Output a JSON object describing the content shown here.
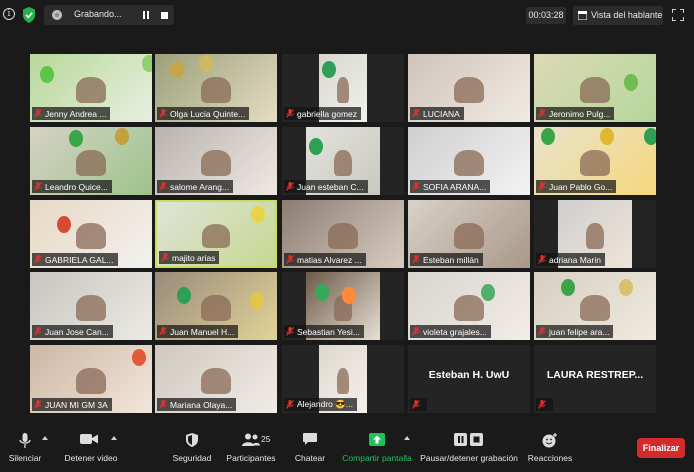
{
  "topbar": {
    "recording_label": "Grabando...",
    "timer": "00:03:28",
    "view_label": "Vista del hablante"
  },
  "participants": [
    {
      "name": "Jenny Andrea ..."
    },
    {
      "name": "Olga Lucia Quinte..."
    },
    {
      "name": "gabriella gomez"
    },
    {
      "name": "LUCIANA"
    },
    {
      "name": "Jeronimo Pulg..."
    },
    {
      "name": "Leandro Quice..."
    },
    {
      "name": "salome Arang..."
    },
    {
      "name": "Juan esteban C..."
    },
    {
      "name": "SOFIA ARANA..."
    },
    {
      "name": "Juan Pablo Go..."
    },
    {
      "name": "GABRIELA GAL..."
    },
    {
      "name": "majito    arias"
    },
    {
      "name": "matias Alvarez ..."
    },
    {
      "name": "Esteban millán"
    },
    {
      "name": "adriana Marin"
    },
    {
      "name": "Juan Jose Can..."
    },
    {
      "name": "Juan Manuel H..."
    },
    {
      "name": "Sebastian Yesi..."
    },
    {
      "name": "violeta grajales..."
    },
    {
      "name": "juan felipe ara..."
    },
    {
      "name": "JUAN MI GM 3A"
    },
    {
      "name": "Mariana Olaya..."
    },
    {
      "name": "Alejandro 😎..."
    },
    {
      "name": "",
      "display_name": "Esteban H. UwU"
    },
    {
      "name": "",
      "display_name": "LAURA  RESTREP..."
    }
  ],
  "toolbar": {
    "mute_label": "Silenciar",
    "video_label": "Detener video",
    "security_label": "Seguridad",
    "participants_label": "Participantes",
    "participants_count": "25",
    "chat_label": "Chatear",
    "share_label": "Compartir pantalla",
    "record_label": "Pausar/detener grabación",
    "reactions_label": "Reacciones",
    "end_label": "Finalizar"
  },
  "colors": {
    "background": "#1a1a1a",
    "active_speaker_border": "#c9de5c",
    "share_green": "#21c25e",
    "end_red": "#d32b2b",
    "muted_red": "#e0322d"
  }
}
